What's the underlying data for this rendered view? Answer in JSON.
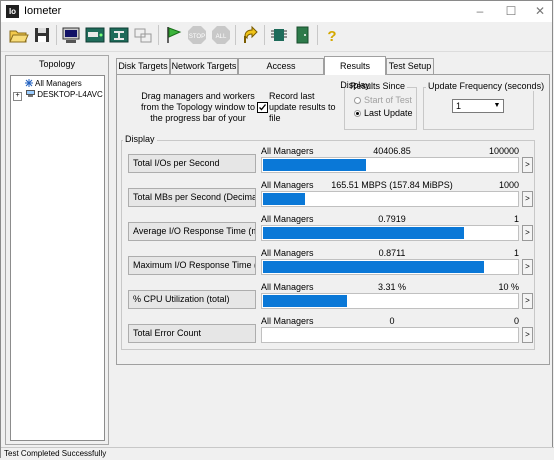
{
  "window": {
    "title": "Iometer",
    "app_icon_text": "Io"
  },
  "toolbar": {
    "buttons": [
      {
        "name": "open-config"
      },
      {
        "name": "save-config"
      },
      {
        "name": "start-new-manager"
      },
      {
        "name": "start-disk-worker"
      },
      {
        "name": "start-network-worker"
      },
      {
        "name": "duplicate-worker"
      },
      {
        "name": "start-test"
      },
      {
        "name": "stop-test"
      },
      {
        "name": "stop-all"
      },
      {
        "name": "reset-workers"
      },
      {
        "name": "disconnect"
      },
      {
        "name": "exit"
      },
      {
        "name": "about"
      }
    ]
  },
  "topology": {
    "title": "Topology",
    "tree": [
      {
        "label": "All Managers",
        "icon": "managers-icon",
        "expander": ""
      },
      {
        "label": "DESKTOP-L4AVC",
        "icon": "computer-icon",
        "expander": "+"
      }
    ]
  },
  "tabs": [
    {
      "label": "Disk Targets",
      "active": false
    },
    {
      "label": "Network Targets",
      "active": false
    },
    {
      "label": "Access Specifications",
      "active": false
    },
    {
      "label": "Results Display",
      "active": true
    },
    {
      "label": "Test Setup",
      "active": false
    }
  ],
  "results": {
    "drag_text": "Drag managers and workers from the Topology window to the progress bar of your",
    "record_text": "Record last update results to file",
    "record_checked": true,
    "results_since": {
      "label": "Results Since",
      "options": [
        {
          "label": "Start of Test",
          "selected": false,
          "enabled": false
        },
        {
          "label": "Last Update",
          "selected": true,
          "enabled": true
        }
      ]
    },
    "update_frequency": {
      "label": "Update Frequency (seconds)",
      "value": "1"
    },
    "display_label": "Display",
    "scroll_glyph": ">",
    "metrics": [
      {
        "button": "Total I/Os per Second",
        "source": "All Managers",
        "value": "40406.85",
        "max": "100000",
        "fill": 0.404
      },
      {
        "button": "Total MBs per Second (Decimal)",
        "source": "All Managers",
        "value": "165.51 MBPS (157.84 MiBPS)",
        "max": "1000",
        "fill": 0.166
      },
      {
        "button": "Average I/O Response Time (ms)",
        "source": "All Managers",
        "value": "0.7919",
        "max": "1",
        "fill": 0.792
      },
      {
        "button": "Maximum I/O Response Time (ms)",
        "source": "All Managers",
        "value": "0.8711",
        "max": "1",
        "fill": 0.871
      },
      {
        "button": "% CPU Utilization (total)",
        "source": "All Managers",
        "value": "3.31 %",
        "max": "10 %",
        "fill": 0.331
      },
      {
        "button": "Total Error Count",
        "source": "All Managers",
        "value": "0",
        "max": "0",
        "fill": 0.0
      }
    ]
  },
  "status_bar": {
    "text": "Test Completed Successfully"
  },
  "colors": {
    "bar": "#0a78d7",
    "background": "#f0f0f0"
  }
}
